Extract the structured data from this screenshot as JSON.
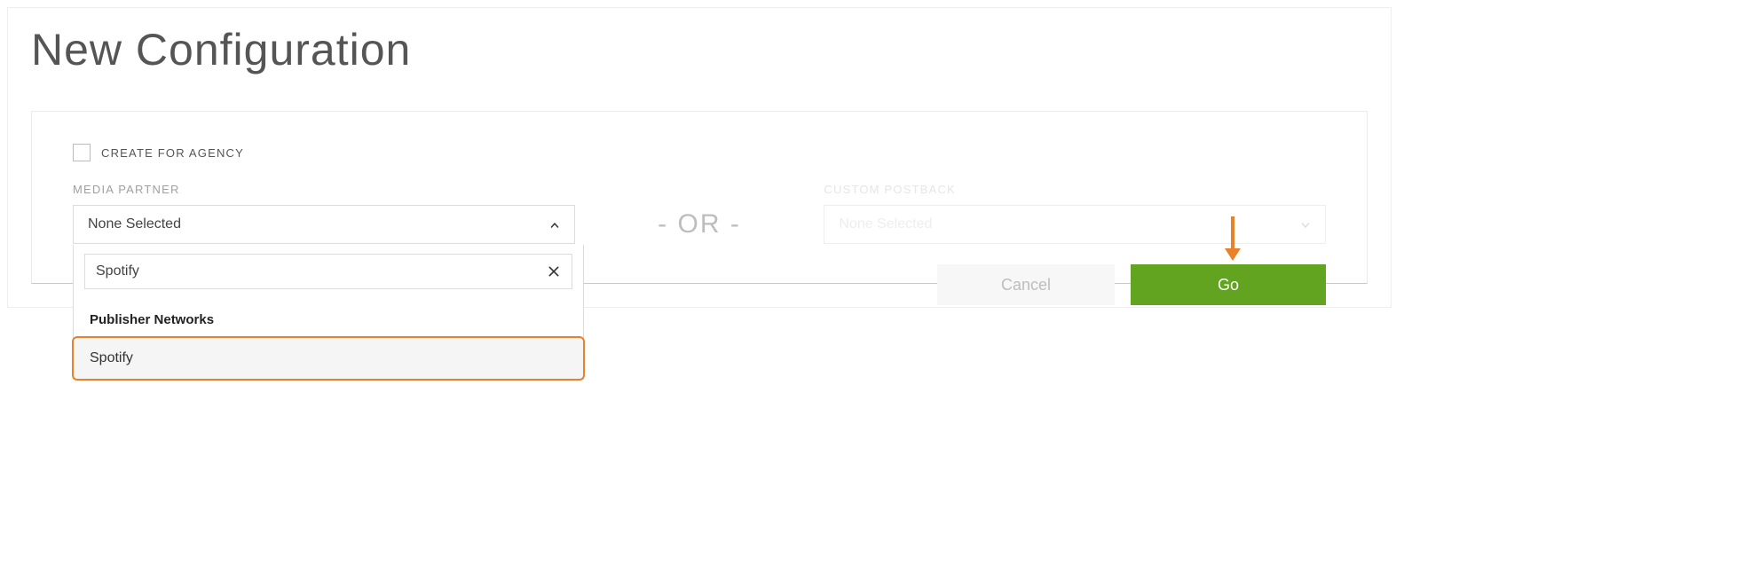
{
  "page": {
    "title": "New Configuration"
  },
  "form": {
    "agency_checkbox_label": "CREATE FOR AGENCY",
    "media_partner": {
      "label": "MEDIA PARTNER",
      "selected": "None Selected",
      "search_value": "Spotify",
      "group_header": "Publisher Networks",
      "option_0": "Spotify"
    },
    "divider": "-  OR  -",
    "custom_postback": {
      "label": "CUSTOM POSTBACK",
      "selected": "None Selected"
    }
  },
  "actions": {
    "cancel": "Cancel",
    "go": "Go"
  }
}
